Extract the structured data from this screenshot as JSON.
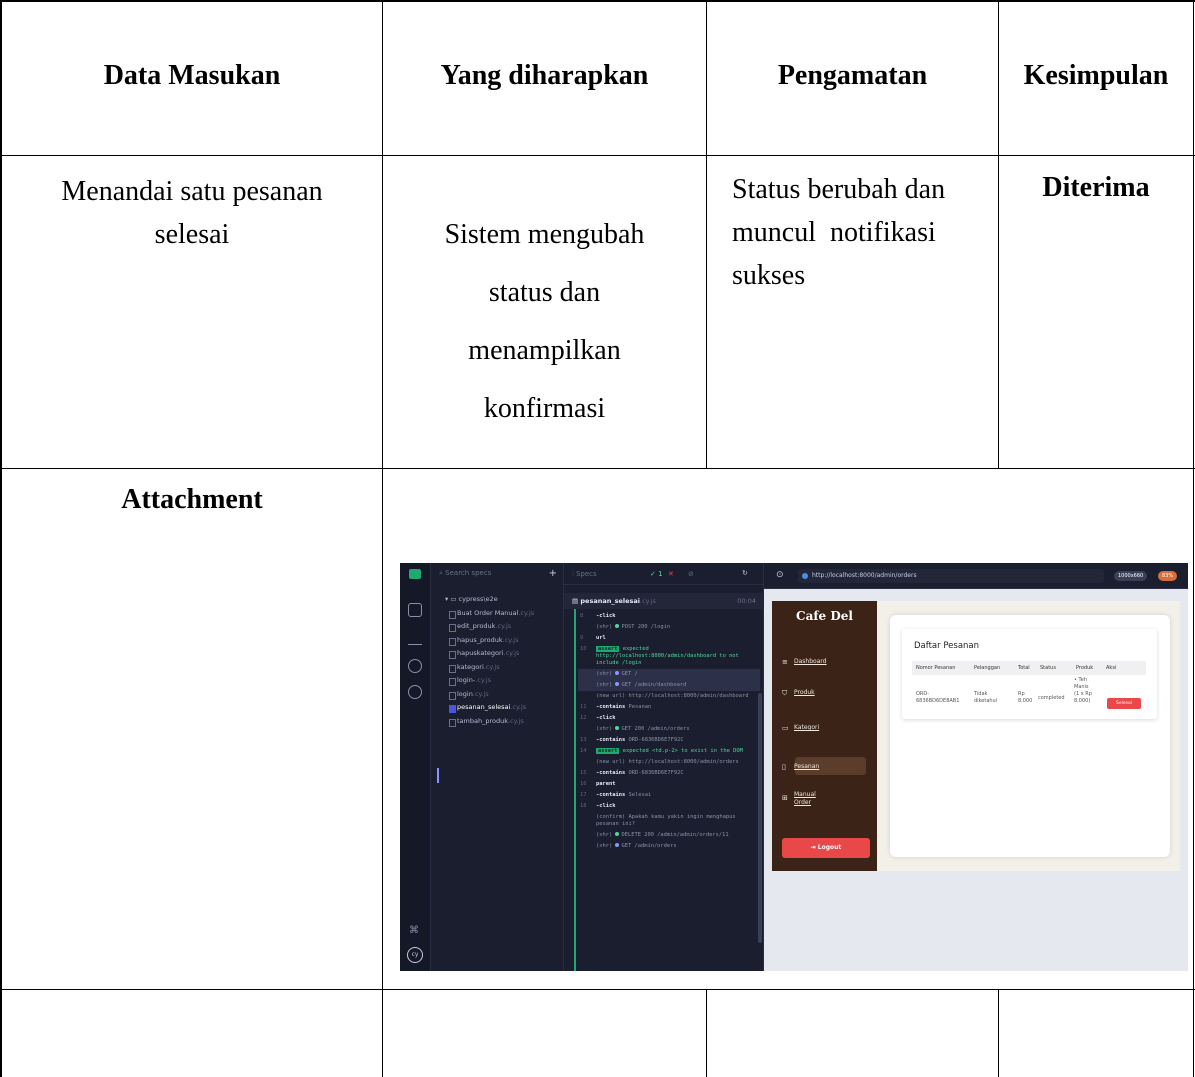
{
  "table": {
    "headers": [
      "Data Masukan",
      "Yang diharapkan",
      "Pengamatan",
      "Kesimpulan"
    ],
    "row1": {
      "input_line1": "Menandai satu pesanan",
      "input_line2": "selesai",
      "expected_lines": [
        "Sistem mengubah",
        "status dan",
        "menampilkan",
        "konfirmasi"
      ],
      "observation_lines": [
        "Status berubah dan",
        "muncul  notifikasi",
        "sukses"
      ],
      "conclusion": "Diterima"
    },
    "attachment_label": "Attachment"
  },
  "screenshot": {
    "specs_search_placeholder": "Search specs",
    "specs_folder": "cypress\\e2e",
    "spec_files": [
      {
        "name": "Buat Order Manual",
        "ext": ".cy.js"
      },
      {
        "name": "edit_produk",
        "ext": ".cy.js"
      },
      {
        "name": "hapus_produk",
        "ext": ".cy.js"
      },
      {
        "name": "hapuskategori",
        "ext": ".cy.js"
      },
      {
        "name": "kategori",
        "ext": ".cy.js"
      },
      {
        "name": "login-",
        "ext": ".cy.js"
      },
      {
        "name": "login",
        "ext": ".cy.js"
      },
      {
        "name": "pesanan_selesai",
        "ext": ".cy.js"
      },
      {
        "name": "tambah_produk",
        "ext": ".cy.js"
      }
    ],
    "runner_tab": "Specs",
    "runner_pass": "✓ 1",
    "runner_fail": "✕",
    "runner_file": "pesanan_selesai",
    "runner_file_ext": ".cy.js",
    "runner_time": "00:04",
    "url": "http://localhost:8000/admin/orders",
    "viewport": "1000x660",
    "zoom": "83%",
    "app": {
      "brand": "Cafe Del",
      "nav": [
        "Dashboard",
        "Produk",
        "Kategori",
        "Pesanan",
        "Manual",
        "Order"
      ],
      "logout": "Logout",
      "title": "Daftar Pesanan",
      "columns": [
        "Nomor Pesanan",
        "Pelanggan",
        "Total",
        "Status",
        "Produk",
        "Aksi"
      ],
      "order_no_1": "ORD-",
      "order_no_2": "6836BD6DE8AB1",
      "customer_1": "Tidak",
      "customer_2": "diketahui",
      "total_1": "Rp",
      "total_2": "8.000",
      "status": "completed",
      "product_lines": [
        "• Teh",
        "Manis",
        "(1 x Rp",
        "8.000)"
      ],
      "action": "Selesai"
    }
  }
}
